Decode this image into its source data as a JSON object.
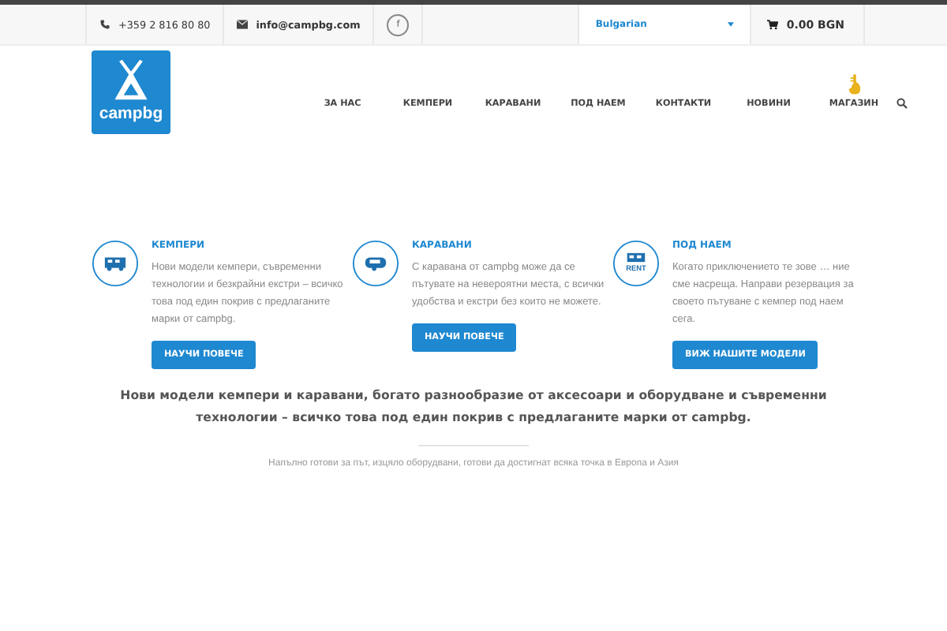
{
  "topbar": {
    "phone": "+359 2 816 80 80",
    "email": "info@campbg.com",
    "facebook": "f",
    "language": "Bulgarian",
    "cart_total": "0.00 BGN"
  },
  "logo": {
    "text": "campbg"
  },
  "nav": [
    {
      "label": "ЗА НАС"
    },
    {
      "label": "КЕМПЕРИ"
    },
    {
      "label": "КАРАВАНИ"
    },
    {
      "label": "ПОД НАЕМ"
    },
    {
      "label": "КОНТАКТИ"
    },
    {
      "label": "НОВИНИ"
    },
    {
      "label": "МАГАЗИН",
      "kind": "shop"
    }
  ],
  "features": [
    {
      "kind": "camper",
      "title": "КЕМПЕРИ",
      "text": "Нови модели кемпери, съвременни технологии и безкрайни екстри – всичко това под един покрив с предлаганите марки от campbg.",
      "button": "НАУЧИ ПОВЕЧЕ"
    },
    {
      "kind": "caravan",
      "title": "КАРАВАНИ",
      "text": "С каравана от campbg може да се пътувате на невероятни места, с всички удобства и екстри без които не можете.",
      "button": "НАУЧИ ПОВЕЧЕ"
    },
    {
      "kind": "rent",
      "icon_label": "RENT",
      "title": "ПОД НАЕМ",
      "text": "Когато приключението те зове … ние сме насреща. Направи резервация за своето пътуване с кемпер под наем сега.",
      "button": "ВИЖ НАШИТЕ МОДЕЛИ"
    }
  ],
  "tagline": "Нови модели кемпери и каравани, богато разнообразие от аксесоари и оборудване и съвременни технологии  – всичко това под един покрив с предлаганите марки от campbg.",
  "subtitle": "Напълно готови за път, изцяло оборудвани, готови да достигнат всяка точка  в Европа и Азия"
}
